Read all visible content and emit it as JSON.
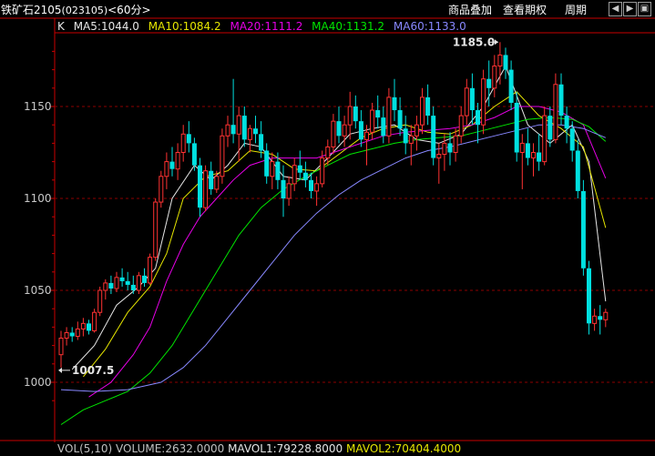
{
  "header": {
    "instrument": "铁矿石2105",
    "code": "(023105)",
    "period": "<60分>",
    "buttons": [
      "商品叠加",
      "查看期权",
      "周期"
    ],
    "nav_icons": [
      "chevron-left-icon",
      "chevron-right-icon",
      "collapse-icon"
    ]
  },
  "legend": {
    "prefix": "K",
    "items": [
      {
        "text": "MA5:1044.0",
        "color": "#e6e6e6"
      },
      {
        "text": "MA10:1084.2",
        "color": "#e6e600"
      },
      {
        "text": "MA20:1111.2",
        "color": "#e600e6"
      },
      {
        "text": "MA40:1131.2",
        "color": "#00e600"
      },
      {
        "text": "MA60:1133.0",
        "color": "#8888ff"
      }
    ]
  },
  "volume": {
    "items": [
      {
        "text": "VOL(5,10)",
        "color": "#c0c0c0"
      },
      {
        "text": "VOLUME:2632.0000",
        "color": "#c0c0c0"
      },
      {
        "text": "MAVOL1:79228.8000",
        "color": "#e6e6e6"
      },
      {
        "text": "MAVOL2:70404.4000",
        "color": "#e6e600"
      }
    ]
  },
  "colors": {
    "up": "#ff3232",
    "down": "#00e0e0",
    "grid": "#8b0000",
    "axis": "#c80000",
    "background": "#000000",
    "text": "#c0c0c0"
  },
  "chart_data": {
    "type": "candlestick",
    "ylim": [
      985,
      1190
    ],
    "yticks": [
      1000,
      1050,
      1100,
      1150
    ],
    "ytick_labels": [
      "1000",
      "1050",
      "1100",
      "1150"
    ],
    "annotations": [
      {
        "text": "1185.0",
        "index": 79
      },
      {
        "text": "1007.5",
        "index": 0
      }
    ],
    "candles": [
      [
        1015,
        1028,
        1008,
        1024
      ],
      [
        1024,
        1030,
        1020,
        1027
      ],
      [
        1027,
        1030,
        1022,
        1025
      ],
      [
        1025,
        1033,
        1023,
        1029
      ],
      [
        1029,
        1035,
        1025,
        1032
      ],
      [
        1032,
        1034,
        1026,
        1028
      ],
      [
        1028,
        1040,
        1027,
        1038
      ],
      [
        1038,
        1052,
        1036,
        1050
      ],
      [
        1050,
        1056,
        1045,
        1054
      ],
      [
        1054,
        1058,
        1048,
        1051
      ],
      [
        1051,
        1060,
        1049,
        1057
      ],
      [
        1057,
        1062,
        1052,
        1055
      ],
      [
        1055,
        1060,
        1050,
        1053
      ],
      [
        1053,
        1058,
        1048,
        1050
      ],
      [
        1050,
        1060,
        1048,
        1058
      ],
      [
        1058,
        1062,
        1052,
        1054
      ],
      [
        1054,
        1070,
        1053,
        1068
      ],
      [
        1068,
        1100,
        1066,
        1098
      ],
      [
        1098,
        1115,
        1095,
        1112
      ],
      [
        1112,
        1125,
        1105,
        1120
      ],
      [
        1120,
        1128,
        1112,
        1116
      ],
      [
        1116,
        1130,
        1110,
        1125
      ],
      [
        1125,
        1140,
        1120,
        1135
      ],
      [
        1135,
        1142,
        1125,
        1130
      ],
      [
        1130,
        1133,
        1115,
        1118
      ],
      [
        1118,
        1122,
        1090,
        1095
      ],
      [
        1095,
        1118,
        1093,
        1115
      ],
      [
        1115,
        1120,
        1102,
        1105
      ],
      [
        1105,
        1115,
        1103,
        1112
      ],
      [
        1112,
        1138,
        1108,
        1134
      ],
      [
        1134,
        1145,
        1128,
        1140
      ],
      [
        1140,
        1165,
        1130,
        1135
      ],
      [
        1135,
        1150,
        1120,
        1145
      ],
      [
        1145,
        1150,
        1128,
        1132
      ],
      [
        1132,
        1140,
        1125,
        1138
      ],
      [
        1138,
        1145,
        1130,
        1135
      ],
      [
        1135,
        1142,
        1122,
        1126
      ],
      [
        1126,
        1130,
        1108,
        1112
      ],
      [
        1112,
        1125,
        1105,
        1120
      ],
      [
        1120,
        1125,
        1105,
        1110
      ],
      [
        1110,
        1118,
        1090,
        1100
      ],
      [
        1100,
        1112,
        1096,
        1108
      ],
      [
        1108,
        1122,
        1104,
        1118
      ],
      [
        1118,
        1126,
        1110,
        1114
      ],
      [
        1114,
        1120,
        1106,
        1110
      ],
      [
        1110,
        1114,
        1100,
        1104
      ],
      [
        1104,
        1112,
        1096,
        1108
      ],
      [
        1108,
        1126,
        1106,
        1122
      ],
      [
        1122,
        1132,
        1118,
        1128
      ],
      [
        1128,
        1146,
        1124,
        1142
      ],
      [
        1142,
        1150,
        1130,
        1134
      ],
      [
        1134,
        1145,
        1128,
        1140
      ],
      [
        1140,
        1158,
        1132,
        1150
      ],
      [
        1150,
        1156,
        1138,
        1142
      ],
      [
        1142,
        1148,
        1128,
        1132
      ],
      [
        1132,
        1140,
        1118,
        1136
      ],
      [
        1136,
        1152,
        1132,
        1148
      ],
      [
        1148,
        1156,
        1138,
        1144
      ],
      [
        1144,
        1150,
        1130,
        1134
      ],
      [
        1134,
        1160,
        1130,
        1155
      ],
      [
        1155,
        1165,
        1142,
        1148
      ],
      [
        1148,
        1155,
        1134,
        1138
      ],
      [
        1138,
        1145,
        1124,
        1130
      ],
      [
        1130,
        1140,
        1118,
        1134
      ],
      [
        1134,
        1145,
        1126,
        1140
      ],
      [
        1140,
        1160,
        1135,
        1155
      ],
      [
        1155,
        1162,
        1140,
        1145
      ],
      [
        1145,
        1150,
        1118,
        1122
      ],
      [
        1122,
        1130,
        1108,
        1124
      ],
      [
        1124,
        1135,
        1115,
        1130
      ],
      [
        1130,
        1136,
        1118,
        1125
      ],
      [
        1125,
        1138,
        1120,
        1134
      ],
      [
        1134,
        1150,
        1130,
        1145
      ],
      [
        1145,
        1165,
        1140,
        1160
      ],
      [
        1160,
        1168,
        1140,
        1148
      ],
      [
        1148,
        1152,
        1130,
        1140
      ],
      [
        1140,
        1170,
        1135,
        1165
      ],
      [
        1165,
        1175,
        1150,
        1160
      ],
      [
        1160,
        1178,
        1155,
        1172
      ],
      [
        1172,
        1185,
        1162,
        1178
      ],
      [
        1178,
        1182,
        1165,
        1170
      ],
      [
        1170,
        1175,
        1148,
        1152
      ],
      [
        1152,
        1158,
        1120,
        1125
      ],
      [
        1125,
        1135,
        1105,
        1130
      ],
      [
        1130,
        1138,
        1118,
        1122
      ],
      [
        1122,
        1130,
        1112,
        1125
      ],
      [
        1125,
        1135,
        1115,
        1120
      ],
      [
        1120,
        1150,
        1118,
        1145
      ],
      [
        1145,
        1150,
        1128,
        1132
      ],
      [
        1132,
        1168,
        1130,
        1162
      ],
      [
        1162,
        1168,
        1140,
        1145
      ],
      [
        1145,
        1150,
        1130,
        1138
      ],
      [
        1138,
        1142,
        1120,
        1126
      ],
      [
        1126,
        1132,
        1100,
        1104
      ],
      [
        1104,
        1110,
        1058,
        1062
      ],
      [
        1062,
        1066,
        1026,
        1032
      ],
      [
        1032,
        1040,
        1028,
        1036
      ],
      [
        1036,
        1042,
        1026,
        1034
      ],
      [
        1034,
        1040,
        1030,
        1038
      ]
    ],
    "ma_series": [
      {
        "name": "MA5",
        "color": "#e6e6e6",
        "points": [
          [
            2,
            1007
          ],
          [
            6,
            1020
          ],
          [
            10,
            1042
          ],
          [
            14,
            1052
          ],
          [
            17,
            1062
          ],
          [
            20,
            1100
          ],
          [
            24,
            1118
          ],
          [
            27,
            1110
          ],
          [
            30,
            1118
          ],
          [
            33,
            1130
          ],
          [
            36,
            1128
          ],
          [
            40,
            1112
          ],
          [
            44,
            1110
          ],
          [
            48,
            1122
          ],
          [
            52,
            1135
          ],
          [
            56,
            1138
          ],
          [
            60,
            1140
          ],
          [
            64,
            1132
          ],
          [
            68,
            1130
          ],
          [
            72,
            1135
          ],
          [
            76,
            1150
          ],
          [
            80,
            1172
          ],
          [
            84,
            1140
          ],
          [
            88,
            1130
          ],
          [
            92,
            1140
          ],
          [
            95,
            1120
          ],
          [
            98,
            1044
          ]
        ]
      },
      {
        "name": "MA10",
        "color": "#e6e600",
        "points": [
          [
            4,
            1003
          ],
          [
            8,
            1018
          ],
          [
            12,
            1038
          ],
          [
            16,
            1052
          ],
          [
            19,
            1070
          ],
          [
            22,
            1100
          ],
          [
            26,
            1112
          ],
          [
            30,
            1115
          ],
          [
            34,
            1126
          ],
          [
            38,
            1124
          ],
          [
            42,
            1116
          ],
          [
            46,
            1115
          ],
          [
            50,
            1124
          ],
          [
            54,
            1133
          ],
          [
            58,
            1138
          ],
          [
            62,
            1140
          ],
          [
            66,
            1136
          ],
          [
            70,
            1135
          ],
          [
            74,
            1140
          ],
          [
            78,
            1150
          ],
          [
            82,
            1158
          ],
          [
            86,
            1145
          ],
          [
            90,
            1138
          ],
          [
            94,
            1128
          ],
          [
            98,
            1084
          ]
        ]
      },
      {
        "name": "MA20",
        "color": "#e600e6",
        "points": [
          [
            5,
            992
          ],
          [
            9,
            1000
          ],
          [
            13,
            1015
          ],
          [
            16,
            1030
          ],
          [
            19,
            1055
          ],
          [
            22,
            1075
          ],
          [
            25,
            1090
          ],
          [
            28,
            1100
          ],
          [
            31,
            1110
          ],
          [
            34,
            1118
          ],
          [
            38,
            1122
          ],
          [
            42,
            1122
          ],
          [
            46,
            1122
          ],
          [
            50,
            1126
          ],
          [
            54,
            1130
          ],
          [
            58,
            1134
          ],
          [
            62,
            1136
          ],
          [
            66,
            1137
          ],
          [
            70,
            1138
          ],
          [
            74,
            1140
          ],
          [
            78,
            1144
          ],
          [
            82,
            1150
          ],
          [
            86,
            1150
          ],
          [
            90,
            1147
          ],
          [
            94,
            1140
          ],
          [
            98,
            1111
          ]
        ]
      },
      {
        "name": "MA40",
        "color": "#00e600",
        "points": [
          [
            0,
            977
          ],
          [
            4,
            985
          ],
          [
            8,
            990
          ],
          [
            12,
            995
          ],
          [
            16,
            1005
          ],
          [
            20,
            1020
          ],
          [
            24,
            1040
          ],
          [
            28,
            1060
          ],
          [
            32,
            1080
          ],
          [
            36,
            1095
          ],
          [
            40,
            1105
          ],
          [
            44,
            1112
          ],
          [
            48,
            1118
          ],
          [
            52,
            1124
          ],
          [
            56,
            1127
          ],
          [
            60,
            1130
          ],
          [
            64,
            1132
          ],
          [
            68,
            1133
          ],
          [
            72,
            1134
          ],
          [
            76,
            1137
          ],
          [
            80,
            1140
          ],
          [
            84,
            1143
          ],
          [
            88,
            1144
          ],
          [
            92,
            1143
          ],
          [
            95,
            1139
          ],
          [
            98,
            1131
          ]
        ]
      },
      {
        "name": "MA60",
        "color": "#8888ff",
        "points": [
          [
            0,
            996
          ],
          [
            6,
            995
          ],
          [
            12,
            996
          ],
          [
            18,
            1000
          ],
          [
            22,
            1008
          ],
          [
            26,
            1020
          ],
          [
            30,
            1035
          ],
          [
            34,
            1050
          ],
          [
            38,
            1065
          ],
          [
            42,
            1080
          ],
          [
            46,
            1092
          ],
          [
            50,
            1102
          ],
          [
            54,
            1110
          ],
          [
            58,
            1116
          ],
          [
            62,
            1122
          ],
          [
            66,
            1126
          ],
          [
            70,
            1128
          ],
          [
            74,
            1131
          ],
          [
            78,
            1134
          ],
          [
            82,
            1137
          ],
          [
            86,
            1140
          ],
          [
            90,
            1140
          ],
          [
            94,
            1138
          ],
          [
            98,
            1133
          ]
        ]
      }
    ]
  }
}
